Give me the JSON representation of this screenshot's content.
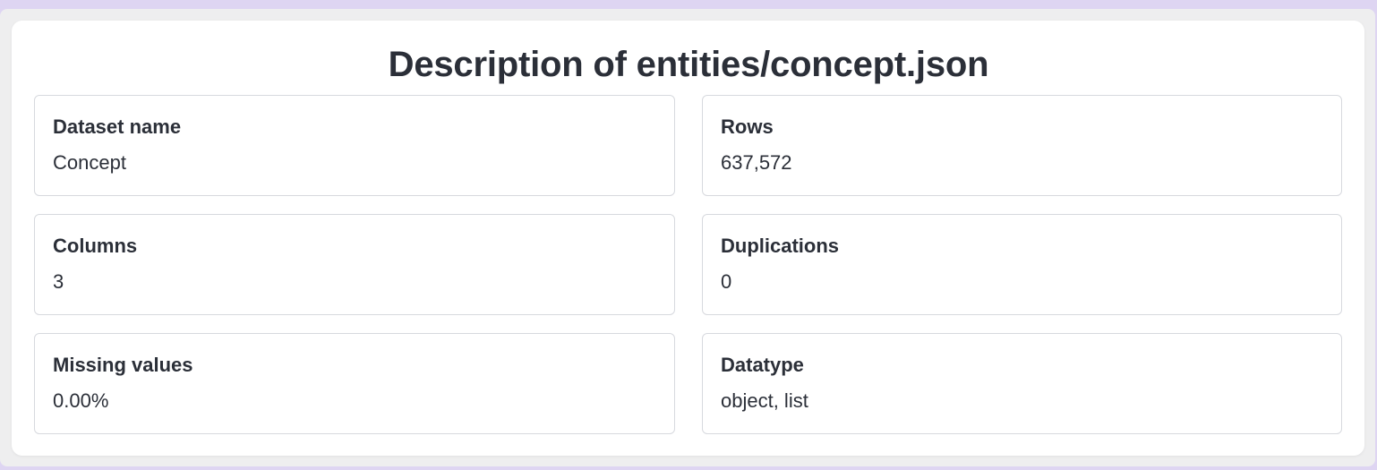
{
  "page": {
    "title": "Description of entities/concept.json"
  },
  "stats": [
    {
      "label": "Dataset name",
      "value": "Concept"
    },
    {
      "label": "Rows",
      "value": "637,572"
    },
    {
      "label": "Columns",
      "value": "3"
    },
    {
      "label": "Duplications",
      "value": "0"
    },
    {
      "label": "Missing values",
      "value": "0.00%"
    },
    {
      "label": "Datatype",
      "value": "object, list"
    }
  ],
  "colors": {
    "background": "#ded5f2",
    "frame": "#eeeeef",
    "card": "#ffffff",
    "text": "#2b2f38",
    "border": "#d7d9de"
  }
}
